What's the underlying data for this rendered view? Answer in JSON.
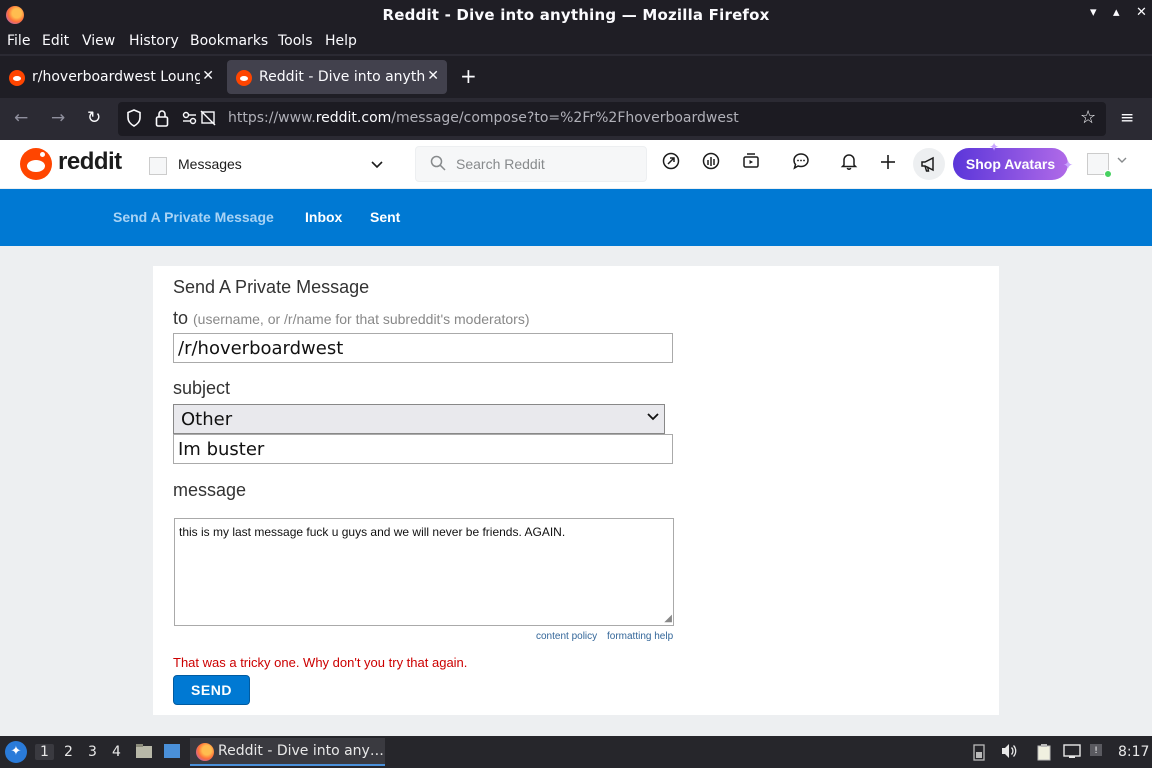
{
  "window": {
    "title": "Reddit - Dive into anything — Mozilla Firefox",
    "controls": [
      "▾",
      "▴",
      "✕"
    ]
  },
  "menubar": [
    "File",
    "Edit",
    "View",
    "History",
    "Bookmarks",
    "Tools",
    "Help"
  ],
  "tabs": [
    {
      "label": "r/hoverboardwest Lounge",
      "active": false,
      "close": "✕"
    },
    {
      "label": "Reddit - Dive into anything",
      "active": true,
      "close": "✕"
    }
  ],
  "newtab_glyph": "+",
  "navbar": {
    "url_prefix": "https://www.",
    "url_domain": "reddit.com",
    "url_path": "/message/compose?to=%2Fr%2Fhoverboardwest",
    "back": "←",
    "forward": "→",
    "reload": "↻",
    "menu": "≡",
    "star": "☆"
  },
  "reddit_header": {
    "wordmark": "reddit",
    "section": "Messages",
    "search_placeholder": "Search Reddit",
    "shop_label": "Shop Avatars"
  },
  "subnav": {
    "send": "Send A Private Message",
    "inbox": "Inbox",
    "sent": "Sent"
  },
  "form": {
    "title": "Send A Private Message",
    "to_label": "to",
    "to_hint": "(username, or /r/name for that subreddit's moderators)",
    "to_value": "/r/hoverboardwest",
    "subject_label": "subject",
    "subject_selected": "Other",
    "subject_value": "Im buster",
    "message_label": "message",
    "message_value": "this is my last message fuck u guys and we will never be friends. AGAIN.",
    "content_policy": "content policy",
    "formatting_help": "formatting help",
    "error": "That was a tricky one. Why don't you try that again.",
    "send_label": "SEND"
  },
  "taskbar": {
    "workspaces": [
      "1",
      "2",
      "3",
      "4"
    ],
    "current_workspace": "1",
    "task_label": "Reddit - Dive into any…",
    "clock": "8:17"
  }
}
